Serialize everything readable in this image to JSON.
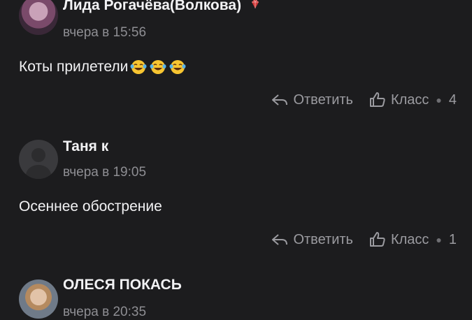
{
  "comments": [
    {
      "author": "Лида Рогачёва(Волкова)",
      "badge_icon": "diamond-icon",
      "time": "вчера в 15:56",
      "text": "Коты прилетели",
      "emoji_icon": "laughing-emoji-icon",
      "emoji_count": 3,
      "reply_label": "Ответить",
      "like_label": "Класс",
      "like_count": "4"
    },
    {
      "author": "Таня к",
      "time": "вчера в 19:05",
      "text": "Осеннее обострение",
      "reply_label": "Ответить",
      "like_label": "Класс",
      "like_count": "1"
    },
    {
      "author": "ОЛЕСЯ ПОКАСЬ",
      "time": "вчера в 20:35"
    }
  ],
  "colors": {
    "background": "#1c1c1e",
    "secondary_text": "#8e8e93",
    "badge": "#d23a3a"
  }
}
